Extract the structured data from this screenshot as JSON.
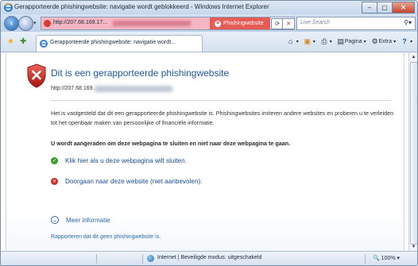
{
  "window": {
    "title": "Gerapporteerde phishingwebsite: navigatie wordt geblokkeerd - Windows Internet Explorer",
    "buttons": {
      "minimize": "–",
      "maximize": "▢",
      "close": "✕"
    }
  },
  "navbar": {
    "url": "http://207.68.169.17...",
    "phishing_badge": "Phishingwebsite",
    "refresh_icon": "⟳",
    "stop_icon": "✕",
    "search_placeholder": "Live Search",
    "search_icon": "search-icon"
  },
  "tabs": {
    "active_label": "Gerapporteerde phishingwebsite: navigatie wordt..."
  },
  "commandbar": {
    "home_icon": "home-icon",
    "feeds_icon": "feeds-icon",
    "print_icon": "print-icon",
    "page_label": "Pagina",
    "tools_label": "Extra",
    "help_icon": "help-icon"
  },
  "page": {
    "heading": "Dit is een gerapporteerde phishingwebsite",
    "url_prefix": "http://207.68.169.",
    "paragraph": "Het is vastgesteld dat dit een gerapporteerde phishingwebsite is. Phishingwebsites imiteren andere websites en proberen u te verleiden tot het openbaar maken van persoonlijke of financiële informatie.",
    "recommendation": "U wordt aangeraden om deze webpagina te sluiten en niet naar deze webpagina te gaan.",
    "close_link": "Klik hier als u deze webpagina wilt sluiten.",
    "continue_link": "Doorgaan naar deze website (niet aanbevolen).",
    "more_info": "Meer informatie",
    "report_link": "Rapporteren dat dit geen phishingwebsite is."
  },
  "statusbar": {
    "zone": "Internet | Beveiligde modus: uitgeschakeld",
    "zoom": "100%"
  },
  "colors": {
    "phishing_red": "#e55c55",
    "address_pink": "#f3b6c2",
    "link_blue": "#1a4d95",
    "heading_blue": "#1d5aa3"
  }
}
